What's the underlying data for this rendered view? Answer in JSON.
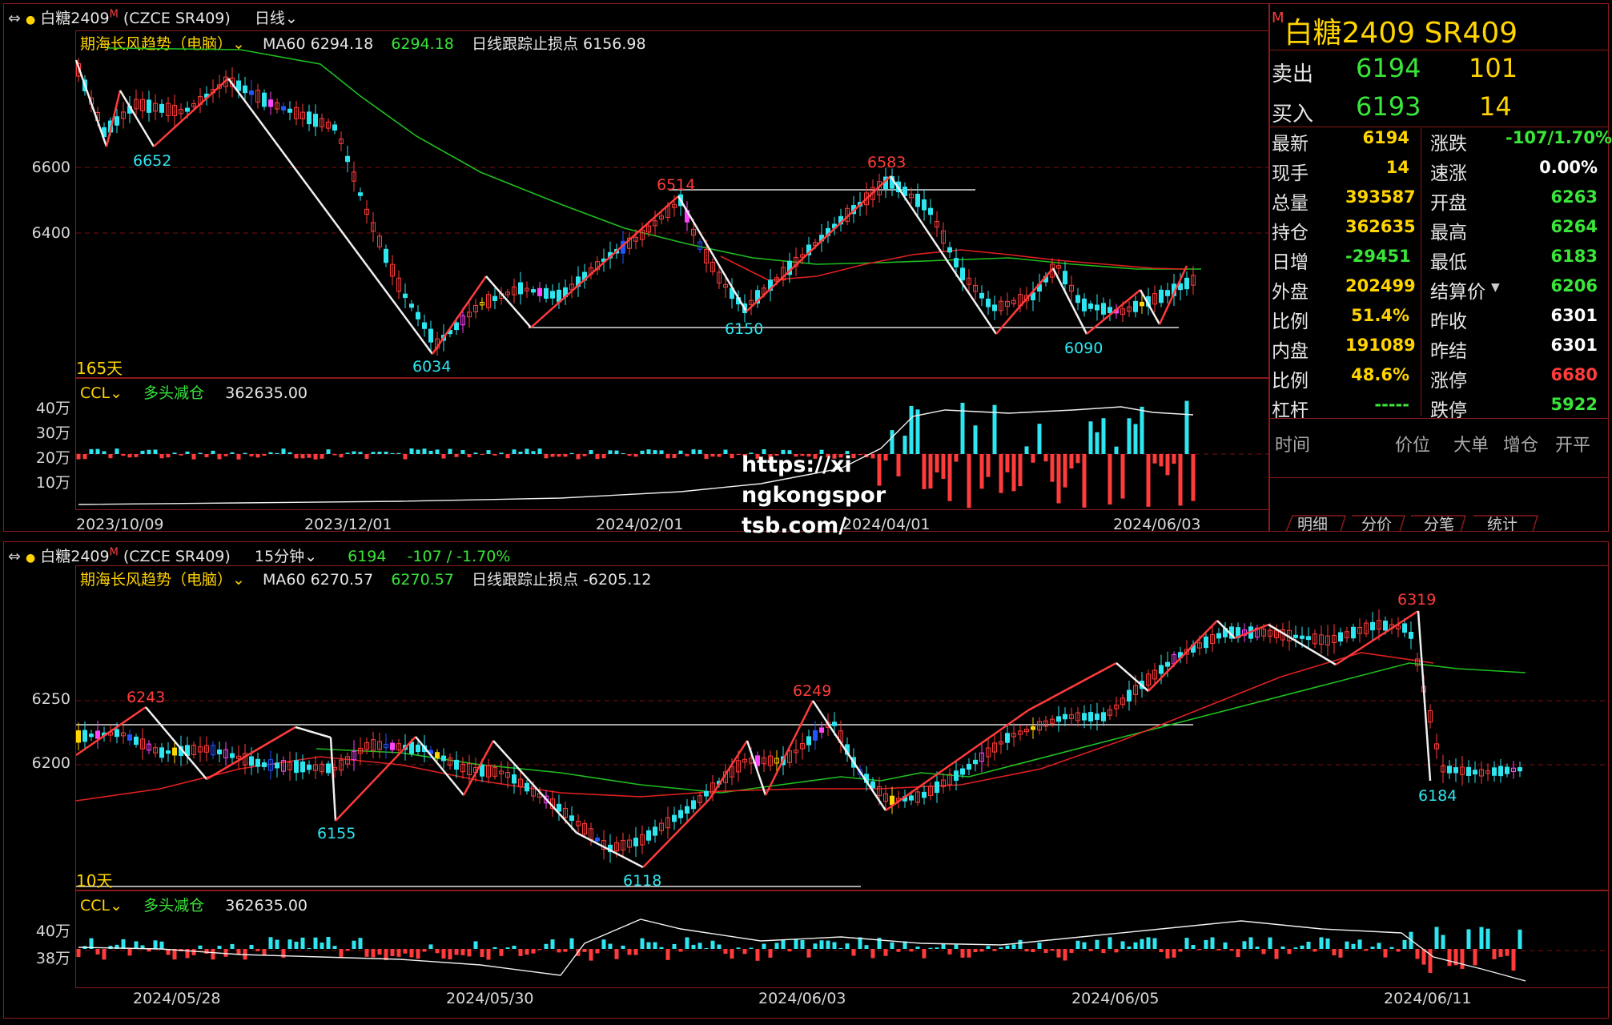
{
  "colors": {
    "up": "#ff3b3b",
    "down": "#2ee6f0",
    "ma_green": "#1fbf1f",
    "ma_red": "#e02020",
    "grid": "#7a1010",
    "text": "#dddddd",
    "yellow": "#ffd400",
    "price_green": "#39e639"
  },
  "top": {
    "title": "白糖2409",
    "title_sup": "M",
    "code": "(CZCE SR409)",
    "period": "日线",
    "indicator": "期海长风趋势（电脑）",
    "ma_label": "MA60 6294.18",
    "ma_value": "6294.18",
    "stop_label": "日线跟踪止损点 6156.98",
    "days": "165天",
    "y_labels": [
      "6600",
      "6400"
    ],
    "x_labels": [
      "2023/10/09",
      "2023/12/01",
      "2024/02/01",
      "2024/04/01",
      "2024/06/03"
    ],
    "annotations": [
      "6652",
      "6034",
      "6514",
      "6150",
      "6583",
      "6090"
    ],
    "sub_indicator": "CCL",
    "sub_state": "多头减仓",
    "sub_value": "362635.00",
    "sub_y_labels": [
      "40万",
      "30万",
      "20万",
      "10万"
    ]
  },
  "bottom": {
    "title": "白糖2409",
    "title_sup": "M",
    "code": "(CZCE SR409)",
    "period": "15分钟",
    "price": "6194",
    "change": "-107 / -1.70%",
    "indicator": "期海长风趋势（电脑）",
    "ma_label": "MA60 6270.57",
    "ma_value": "6270.57",
    "stop_label": "日线跟踪止损点 -6205.12",
    "days": "10天",
    "y_labels": [
      "6250",
      "6200"
    ],
    "x_labels": [
      "2024/05/28",
      "2024/05/30",
      "2024/06/03",
      "2024/06/05",
      "2024/06/11"
    ],
    "annotations": [
      "6243",
      "6155",
      "6118",
      "6249",
      "6319",
      "6184"
    ],
    "sub_indicator": "CCL",
    "sub_state": "多头减仓",
    "sub_value": "362635.00",
    "sub_y_labels": [
      "40万",
      "38万"
    ]
  },
  "quote": {
    "title": "白糖2409  SR409",
    "title_sup": "M",
    "sell_label": "卖出",
    "sell_price": "6194",
    "sell_vol": "101",
    "buy_label": "买入",
    "buy_price": "6193",
    "buy_vol": "14",
    "rows": [
      {
        "l": "最新",
        "lv": "6194",
        "r": "涨跌",
        "rv": "-107/1.70%"
      },
      {
        "l": "现手",
        "lv": "14",
        "r": "速涨",
        "rv": "0.00%"
      },
      {
        "l": "总量",
        "lv": "393587",
        "r": "开盘",
        "rv": "6263"
      },
      {
        "l": "持仓",
        "lv": "362635",
        "r": "最高",
        "rv": "6264"
      },
      {
        "l": "日增",
        "lv": "-29451",
        "r": "最低",
        "rv": "6183"
      },
      {
        "l": "外盘",
        "lv": "202499",
        "r": "结算价",
        "rv": "6206"
      },
      {
        "l": "比例",
        "lv": "51.4%",
        "r": "昨收",
        "rv": "6301"
      },
      {
        "l": "内盘",
        "lv": "191089",
        "r": "昨结",
        "rv": "6301"
      },
      {
        "l": "比例",
        "lv": "48.6%",
        "r": "涨停",
        "rv": "6680"
      },
      {
        "l": "杠杆",
        "lv": "-----",
        "r": "跌停",
        "rv": "5922"
      }
    ],
    "tick_headers": [
      "时间",
      "价位",
      "大单",
      "增仓",
      "开平"
    ],
    "tabs": [
      "明细",
      "分价",
      "分笔",
      "统计"
    ]
  },
  "watermark": [
    "https://xi",
    "ngkongspor",
    "tsb.com/"
  ]
}
